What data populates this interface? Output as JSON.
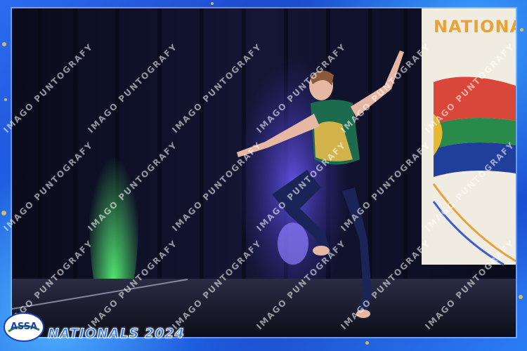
{
  "photo": {
    "description_alt": "Performer in teal and gold top mid-pose on stage"
  },
  "banner": {
    "text": "NATIONA"
  },
  "footer": {
    "event_title": "NATIONALS 2024",
    "logo_text": "ASSA"
  },
  "watermark": {
    "text": "IMAGO PUNTOGRAFY"
  },
  "colors": {
    "border_blue": "#1f4fd6",
    "accent_gold": "#e8c95a",
    "costume_green": "#1c6b4f"
  }
}
